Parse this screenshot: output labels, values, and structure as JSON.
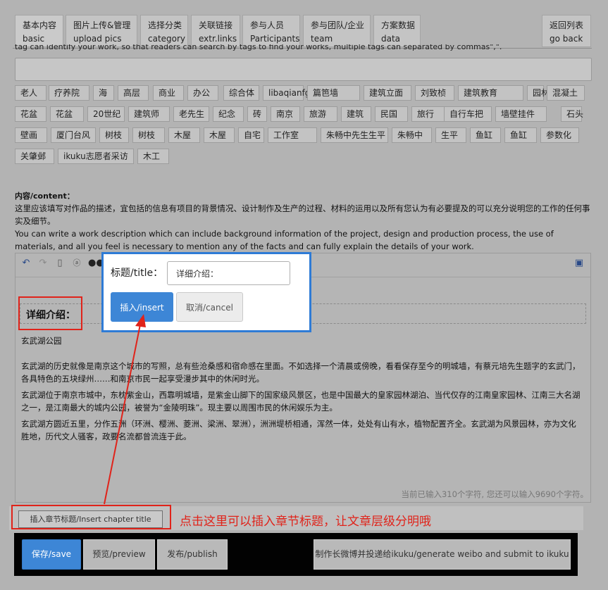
{
  "tabs": [
    {
      "zh": "基本内容",
      "en": "basic"
    },
    {
      "zh": "图片上传&管理",
      "en": "upload pics"
    },
    {
      "zh": "选择分类",
      "en": "category"
    },
    {
      "zh": "关联链接",
      "en": "extr.links"
    },
    {
      "zh": "参与人员",
      "en": "Participants"
    },
    {
      "zh": "参与团队/企业",
      "en": "team"
    },
    {
      "zh": "方案数据",
      "en": "data"
    }
  ],
  "back": {
    "zh": "返回列表",
    "en": "go back"
  },
  "tags_hint": "tag can identify your work, so that readers can search by tags to find your works, multiple tags can separated by commas\",\".",
  "tag_input_value": "",
  "tags": [
    "老人",
    "疗养院",
    "海",
    "高层",
    "商业",
    "办公",
    "综合体",
    "libaqianfg",
    "篇笆墙",
    "建筑立面",
    "刘致桢",
    "建筑教育",
    "园林",
    "混凝土",
    "花盆",
    "花盆",
    "20世纪",
    "建筑师",
    "老先生",
    "纪念",
    "砖",
    "南京",
    "旅游",
    "建筑",
    "民国",
    "旅行",
    "自行车把",
    "墙壁挂件",
    "石头",
    "壁画",
    "厦门台风",
    "树枝",
    "树枝",
    "木屋",
    "木屋",
    "自宅",
    "工作室",
    "朱畅中先生生平",
    "朱畅中",
    "生平",
    "鱼缸",
    "鱼缸",
    "参数化",
    "关肇邺",
    "ikuku志愿者采访",
    "木工"
  ],
  "content": {
    "label": "内容/content：",
    "desc_zh": "这里应该填写对作品的描述，宜包括的信息有项目的背景情况、设计制作及生产的过程、材料的运用以及所有您认为有必要提及的可以充分说明您的工作的任何事实及细节。",
    "desc_en": "You can write a work description which can include background information of the project, design and production process, the use of materials, and all you feel is necessary to mention any of the facts and can fully explain the details of your work."
  },
  "editor": {
    "chapter_title": "详细介绍：",
    "place": "玄武湖公园",
    "paragraphs": [
      "玄武湖的历史就像是南京这个城市的写照，总有些沧桑感和宿命感在里面。不如选择一个清晨或傍晚，看看保存至今的明城墙，有蔡元培先生题字的玄武门，各具特色的五块绿州……和南京市民一起享受漫步其中的休闲时光。",
      "玄武湖位于南京市城中，东枕紫金山，西靠明城墙，是紫金山脚下的国家级风景区，也是中国最大的皇家园林湖泊、当代仅存的江南皇家园林、江南三大名湖之一，是江南最大的城内公园，被誉为“金陵明珠”。现主要以周围市民的休闲娱乐为主。",
      "玄武湖方圆近五里，分作五洲（环洲、樱洲、菱洲、梁洲、翠洲），洲洲堤桥相通，浑然一体，处处有山有水，植物配置齐全。玄武湖为风景园林，亦为文化胜地，历代文人骚客，政要名流都曾流连于此。"
    ],
    "counter": "当前已输入310个字符, 您还可以输入9690个字符。"
  },
  "dialog": {
    "label": "标题/title：",
    "input_value": "详细介绍：",
    "insert": "插入/insert",
    "cancel": "取消/cancel"
  },
  "insert_chapter": "插入章节标题/Insert chapter title",
  "annotation": "点击这里可以插入章节标题，让文章层级分明哦",
  "actions": {
    "save": "保存/save",
    "preview": "预览/preview",
    "publish": "发布/publish",
    "weibo": "制作长微博并投递给ikuku/generate weibo and submit to ikuku"
  },
  "colors": {
    "accent": "#3d86d6",
    "annotation": "#e0231a",
    "dialog_border": "#2e7bd6"
  }
}
